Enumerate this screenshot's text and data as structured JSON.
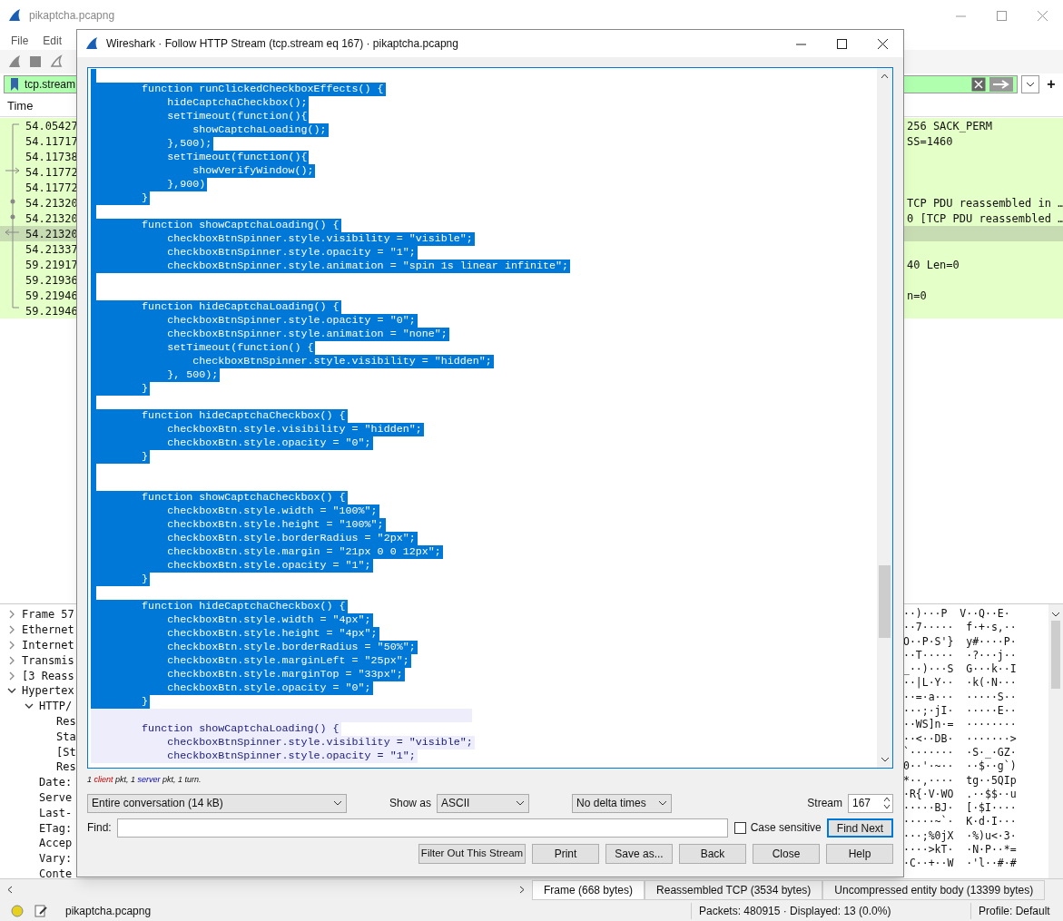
{
  "main_window": {
    "title": "pikaptcha.pcapng",
    "menu": [
      "File",
      "Edit"
    ],
    "filter": {
      "value": "tcp.stream",
      "add_label": "+"
    },
    "packet_list": {
      "columns": [
        "Time"
      ],
      "rows": [
        {
          "time": "54.05427",
          "info": "256 SACK_PERM",
          "selected": false
        },
        {
          "time": "54.11717",
          "info": "SS=1460",
          "selected": false
        },
        {
          "time": "54.11738",
          "selected": false
        },
        {
          "time": "54.11772",
          "selected": false
        },
        {
          "time": "54.11772",
          "selected": false
        },
        {
          "time": "54.21320",
          "info": "TCP PDU reassembled in …",
          "selected": false
        },
        {
          "time": "54.21320",
          "info": "0 [TCP PDU reassembled …",
          "selected": false
        },
        {
          "time": "54.21320",
          "selected": true
        },
        {
          "time": "54.21337",
          "selected": false
        },
        {
          "time": "59.21917",
          "info": "40 Len=0",
          "selected": false
        },
        {
          "time": "59.21936",
          "selected": false
        },
        {
          "time": "59.21946",
          "info": "n=0",
          "selected": false
        },
        {
          "time": "59.21946",
          "selected": false
        }
      ]
    },
    "details": [
      {
        "text": "Frame 57",
        "expanded": false
      },
      {
        "text": "Ethernet",
        "expanded": false
      },
      {
        "text": "Internet",
        "expanded": false
      },
      {
        "text": "Transmis",
        "expanded": false
      },
      {
        "text": "[3 Reass",
        "expanded": false
      },
      {
        "text": "Hypertex",
        "expanded": true,
        "children": [
          {
            "text": "HTTP/",
            "expanded": true,
            "children": [
              {
                "text": "Res"
              },
              {
                "text": "Sta"
              },
              {
                "text": "[St"
              },
              {
                "text": "Res"
              }
            ]
          },
          {
            "text": "Date:"
          },
          {
            "text": "Serve"
          },
          {
            "text": "Last-"
          },
          {
            "text": "ETag:"
          },
          {
            "text": "Accep"
          },
          {
            "text": "Vary:"
          },
          {
            "text": "Conte"
          }
        ]
      }
    ],
    "bytes": [
      "··)···P  V··Q··E·",
      "··7·····  f·+·s,··",
      "O··P·S'}  y#····P·",
      "··T·····  ·?···j··",
      "_··)···S  G···k··I",
      "··|L·Y··  ·k(·N···",
      "··=·a···  ·····S··",
      "···;·jI·  ·····E··",
      "··WS]n·=  ········",
      "··<··DB·  ·······>",
      "`·······  ·S·_·GZ·",
      "0··'·~··  ··$··g`)",
      "*··,····  tg··5QIp",
      "·R{·V·WO  .··$$··u",
      "·····BJ·  [·$I····",
      "·····~`·  K·d·I···",
      "···;%0jX  ·%)u<·3·",
      "····>kT·  ·N·P··*=",
      "·C··+··W  ·'l··#·#"
    ],
    "byte_tabs": [
      {
        "label": "Frame (668 bytes)",
        "selected": true
      },
      {
        "label": "Reassembled TCP (3534 bytes)",
        "selected": false
      },
      {
        "label": "Uncompressed entity body (13399 bytes)",
        "selected": false
      }
    ],
    "status_bar": {
      "file": "pikaptcha.pcapng",
      "packets": "Packets: 480915 · Displayed: 13 (0.0%)",
      "profile": "Profile: Default"
    }
  },
  "dialog": {
    "title": "Wireshark · Follow HTTP Stream (tcp.stream eq 167) · pikaptcha.pcapng",
    "lines": [
      {
        "kind": "blank",
        "selected": true
      },
      {
        "kind": "code",
        "text": "        function runClickedCheckboxEffects() {",
        "selected": true
      },
      {
        "kind": "code",
        "text": "            hideCaptchaCheckbox();",
        "selected": true
      },
      {
        "kind": "code",
        "text": "            setTimeout(function(){",
        "selected": true
      },
      {
        "kind": "code",
        "text": "                showCaptchaLoading();",
        "selected": true
      },
      {
        "kind": "code",
        "text": "            },500);",
        "selected": true
      },
      {
        "kind": "code",
        "text": "            setTimeout(function(){",
        "selected": true
      },
      {
        "kind": "code",
        "text": "                showVerifyWindow();",
        "selected": true
      },
      {
        "kind": "code",
        "text": "            },900)",
        "selected": true
      },
      {
        "kind": "code",
        "text": "        }",
        "selected": true
      },
      {
        "kind": "blank",
        "selected": true
      },
      {
        "kind": "code",
        "text": "        function showCaptchaLoading() {",
        "selected": true
      },
      {
        "kind": "code",
        "text": "            checkboxBtnSpinner.style.visibility = \"visible\";",
        "selected": true
      },
      {
        "kind": "code",
        "text": "            checkboxBtnSpinner.style.opacity = \"1\";",
        "selected": true
      },
      {
        "kind": "code",
        "text": "            checkboxBtnSpinner.style.animation = \"spin 1s linear infinite\";",
        "selected": true
      },
      {
        "kind": "blank",
        "selected": true
      },
      {
        "kind": "blank",
        "selected": true
      },
      {
        "kind": "code",
        "text": "        function hideCaptchaLoading() {",
        "selected": true
      },
      {
        "kind": "code",
        "text": "            checkboxBtnSpinner.style.opacity = \"0\";",
        "selected": true
      },
      {
        "kind": "code",
        "text": "            checkboxBtnSpinner.style.animation = \"none\";",
        "selected": true
      },
      {
        "kind": "code",
        "text": "            setTimeout(function() {",
        "selected": true
      },
      {
        "kind": "code",
        "text": "                checkboxBtnSpinner.style.visibility = \"hidden\";",
        "selected": true
      },
      {
        "kind": "code",
        "text": "            }, 500);",
        "selected": true
      },
      {
        "kind": "code",
        "text": "        }",
        "selected": true
      },
      {
        "kind": "blank",
        "selected": true
      },
      {
        "kind": "code",
        "text": "        function hideCaptchaCheckbox() {",
        "selected": true
      },
      {
        "kind": "code",
        "text": "            checkboxBtn.style.visibility = \"hidden\";",
        "selected": true
      },
      {
        "kind": "code",
        "text": "            checkboxBtn.style.opacity = \"0\";",
        "selected": true
      },
      {
        "kind": "code",
        "text": "        }",
        "selected": true
      },
      {
        "kind": "blank",
        "selected": true
      },
      {
        "kind": "blank",
        "selected": true
      },
      {
        "kind": "code",
        "text": "        function showCaptchaCheckbox() {",
        "selected": true
      },
      {
        "kind": "code",
        "text": "            checkboxBtn.style.width = \"100%\";",
        "selected": true
      },
      {
        "kind": "code",
        "text": "            checkboxBtn.style.height = \"100%\";",
        "selected": true
      },
      {
        "kind": "code",
        "text": "            checkboxBtn.style.borderRadius = \"2px\";",
        "selected": true
      },
      {
        "kind": "code",
        "text": "            checkboxBtn.style.margin = \"21px 0 0 12px\";",
        "selected": true
      },
      {
        "kind": "code",
        "text": "            checkboxBtn.style.opacity = \"1\";",
        "selected": true
      },
      {
        "kind": "code",
        "text": "        }",
        "selected": true
      },
      {
        "kind": "blank",
        "selected": true
      },
      {
        "kind": "code",
        "text": "        function hideCaptchaCheckbox() {",
        "selected": true
      },
      {
        "kind": "code",
        "text": "            checkboxBtn.style.width = \"4px\";",
        "selected": true
      },
      {
        "kind": "code",
        "text": "            checkboxBtn.style.height = \"4px\";",
        "selected": true
      },
      {
        "kind": "code",
        "text": "            checkboxBtn.style.borderRadius = \"50%\";",
        "selected": true
      },
      {
        "kind": "code",
        "text": "            checkboxBtn.style.marginLeft = \"25px\";",
        "selected": true
      },
      {
        "kind": "code",
        "text": "            checkboxBtn.style.marginTop = \"33px\";",
        "selected": true
      },
      {
        "kind": "code",
        "text": "            checkboxBtn.style.opacity = \"0\";",
        "selected": true
      },
      {
        "kind": "code",
        "text": "        }",
        "selected": true
      },
      {
        "kind": "blank",
        "selected": false
      },
      {
        "kind": "code",
        "text": "        function showCaptchaLoading() {",
        "selected": false
      },
      {
        "kind": "code",
        "text": "            checkboxBtnSpinner.style.visibility = \"visible\";",
        "selected": false
      },
      {
        "kind": "code",
        "text": "            checkboxBtnSpinner.style.opacity = \"1\";",
        "selected": false
      }
    ],
    "summary": [
      {
        "text": "1 "
      },
      {
        "text": "client",
        "kind": "client"
      },
      {
        "text": " pkt, 1 "
      },
      {
        "text": "server",
        "kind": "server"
      },
      {
        "text": " pkt, 1 turn."
      }
    ],
    "conversation": "Entire conversation (14 kB)",
    "show_as_label": "Show as",
    "show_as": "ASCII",
    "delta": "No delta times",
    "stream_label": "Stream",
    "stream": "167",
    "find_label": "Find:",
    "case_sensitive": {
      "label": "Case sensitive",
      "checked": false
    },
    "find_next": "Find Next",
    "buttons": [
      "Filter Out This Stream",
      "Print",
      "Save as...",
      "Back",
      "Close",
      "Help"
    ]
  }
}
